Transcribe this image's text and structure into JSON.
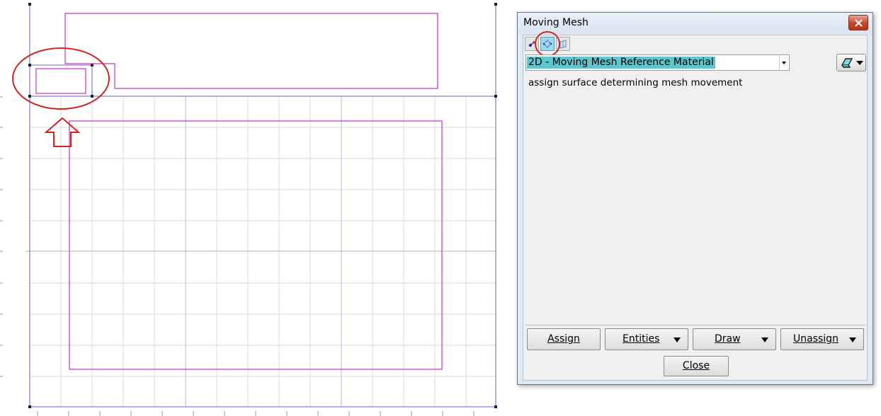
{
  "dialog": {
    "title": "Moving Mesh",
    "material": "2D - Moving Mesh Reference Material",
    "description": "assign surface determining mesh movement",
    "tabs": [
      {
        "icon": "point-tool-icon"
      },
      {
        "icon": "line-tool-icon"
      },
      {
        "icon": "surface-tool-icon"
      }
    ],
    "buttons": {
      "assign": "Assign",
      "entities": "Entities",
      "draw": "Draw",
      "unassign": "Unassign",
      "close": "Close"
    }
  },
  "colors": {
    "geometry": "#c832c8",
    "grid": "#d9d9d9",
    "axis": "#6464d2",
    "highlight": "#5fc6cf",
    "annotation": "#d32424"
  }
}
